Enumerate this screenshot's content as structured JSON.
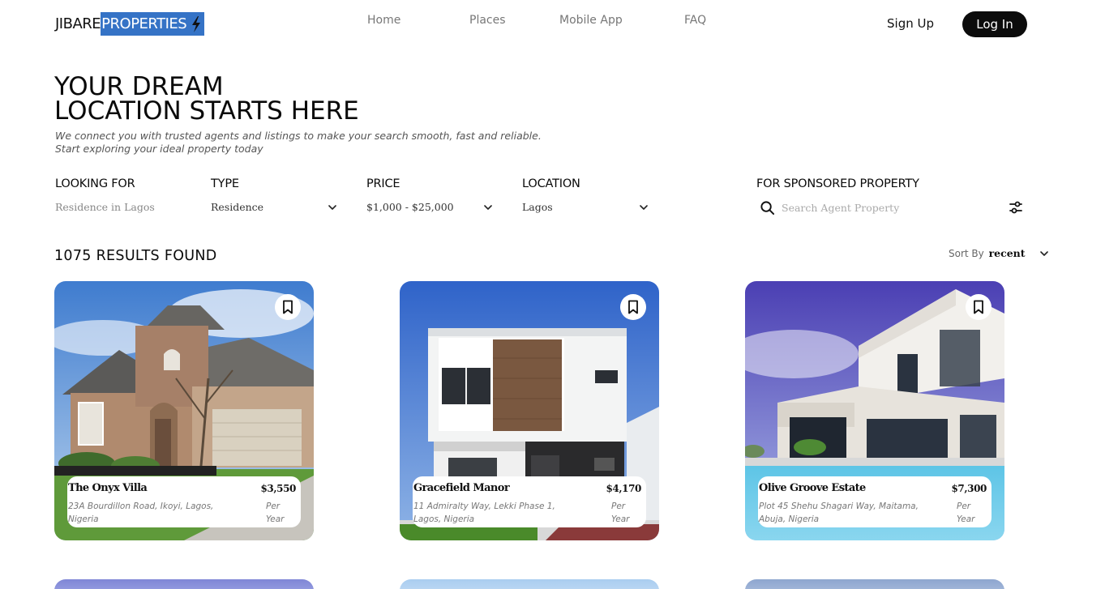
{
  "brand": {
    "part1": "JIBARE",
    "part2": "PROPERTIES",
    "accent_color": "#3573c6",
    "icon": "lightning-bolt-icon"
  },
  "nav": {
    "items": [
      {
        "label": "Home"
      },
      {
        "label": "Places"
      },
      {
        "label": "Mobile App"
      },
      {
        "label": "FAQ"
      }
    ]
  },
  "auth": {
    "signup_label": "Sign Up",
    "login_label": "Log In"
  },
  "hero": {
    "title_line1": "YOUR DREAM",
    "title_line2": "LOCATION STARTS HERE",
    "subtitle_line1": "We connect you with trusted agents and listings to make your search smooth, fast and reliable.",
    "subtitle_line2": "Start exploring your ideal property today"
  },
  "filters": {
    "looking_for": {
      "label": "LOOKING FOR",
      "value": "Residence in Lagos"
    },
    "type": {
      "label": "TYPE",
      "value": "Residence"
    },
    "price": {
      "label": "PRICE",
      "value": "$1,000 - $25,000"
    },
    "location": {
      "label": "LOCATION",
      "value": "Lagos"
    },
    "sponsored": {
      "label": "FOR SPONSORED PROPERTY",
      "placeholder": "Search Agent Property"
    }
  },
  "results": {
    "count_text": "1075 RESULTS FOUND",
    "sort_label": "Sort By",
    "sort_value": "recent"
  },
  "listings": [
    {
      "name": "The Onyx Villa",
      "address": "23A Bourdillon Road, Ikoyi, Lagos, Nigeria",
      "price": "$3,550",
      "period": "Per Year"
    },
    {
      "name": "Gracefield Manor",
      "address": "11 Admiralty Way, Lekki Phase 1, Lagos, Nigeria",
      "price": "$4,170",
      "period": "Per Year"
    },
    {
      "name": "Olive Groove Estate",
      "address": "Plot 45 Shehu Shagari Way, Maitama, Abuja, Nigeria",
      "price": "$7,300",
      "period": "Per Year"
    }
  ]
}
